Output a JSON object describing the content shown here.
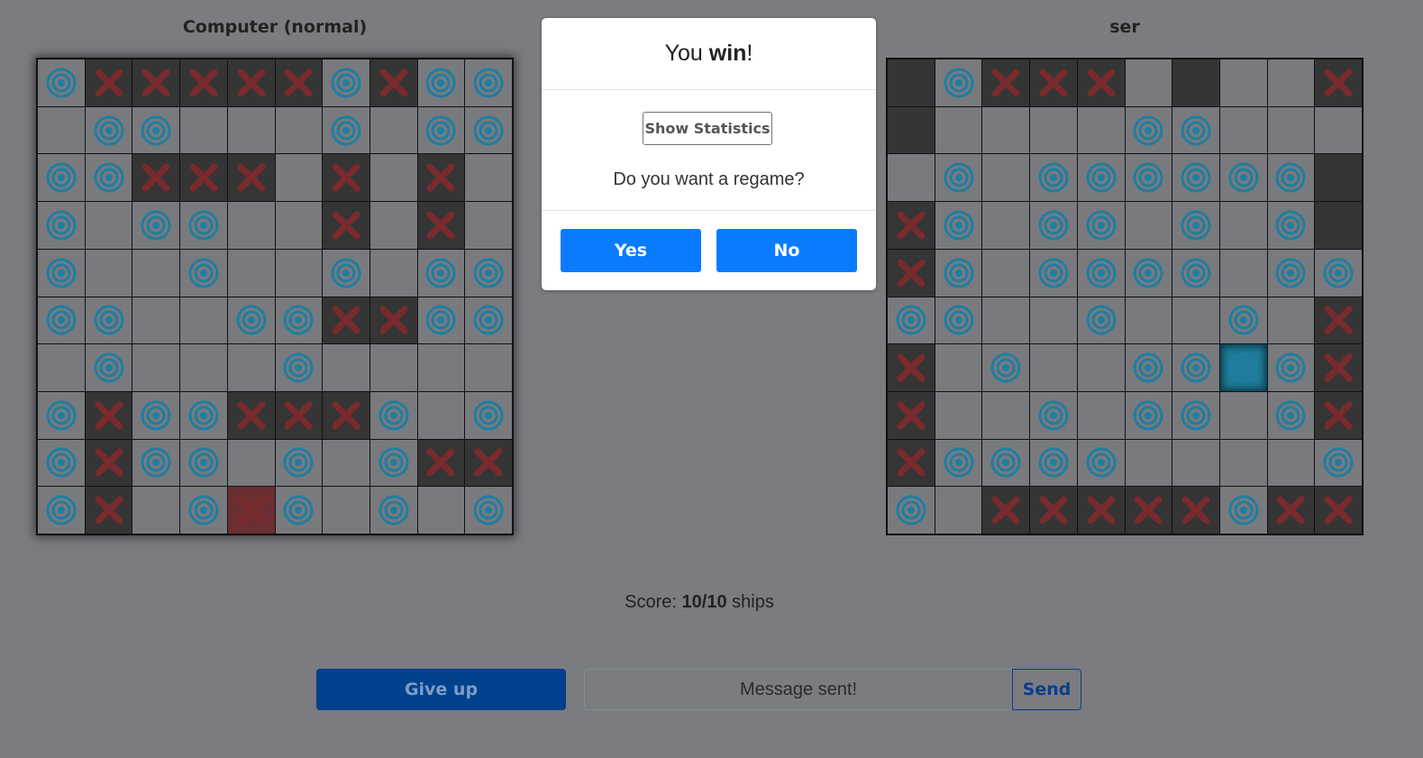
{
  "colors": {
    "background": "#7b7c80",
    "cell_empty": "#797a7e",
    "cell_ship": "#353535",
    "last_hit": "#6b2f33",
    "hit_marker": "#7a2a2c",
    "miss_marker": "#1e7ea1",
    "primary_button": "#0a7bff",
    "give_up_button": "#00418c"
  },
  "boards": {
    "left": {
      "title": "Computer (normal)",
      "legend": "O = miss (target icon), X = hit, S = ship shown, . = empty, L = last hit",
      "rows": [
        [
          "O",
          "X",
          "X",
          "X",
          "X",
          "X",
          "O",
          "X",
          "O",
          "O"
        ],
        [
          ".",
          "O",
          "O",
          ".",
          ".",
          ".",
          "O",
          ".",
          "O",
          "O"
        ],
        [
          "O",
          "O",
          "X",
          "X",
          "X",
          ".",
          "X",
          ".",
          "X",
          "."
        ],
        [
          "O",
          ".",
          "O",
          "O",
          ".",
          ".",
          "X",
          ".",
          "X",
          "."
        ],
        [
          "O",
          ".",
          ".",
          "O",
          ".",
          ".",
          "O",
          ".",
          "O",
          "O"
        ],
        [
          "O",
          "O",
          ".",
          ".",
          "O",
          "O",
          "X",
          "X",
          "O",
          "O"
        ],
        [
          ".",
          "O",
          ".",
          ".",
          ".",
          "O",
          ".",
          ".",
          ".",
          "."
        ],
        [
          "O",
          "X",
          "O",
          "O",
          "X",
          "X",
          "X",
          "O",
          ".",
          "O"
        ],
        [
          "O",
          "X",
          "O",
          "O",
          ".",
          "O",
          ".",
          "O",
          "X",
          "X"
        ],
        [
          "O",
          "X",
          ".",
          "O",
          "L",
          "O",
          ".",
          "O",
          ".",
          "O"
        ]
      ]
    },
    "right": {
      "title": "ser",
      "rows": [
        [
          "S",
          "O",
          "X",
          "X",
          "X",
          ".",
          "S",
          ".",
          ".",
          "X"
        ],
        [
          "S",
          ".",
          ".",
          ".",
          ".",
          "O",
          "O",
          ".",
          ".",
          "."
        ],
        [
          ".",
          "O",
          ".",
          "O",
          "O",
          "O",
          "O",
          "O",
          "O",
          "S"
        ],
        [
          "X",
          "O",
          ".",
          "O",
          "O",
          ".",
          "O",
          ".",
          "O",
          "S"
        ],
        [
          "X",
          "O",
          ".",
          "O",
          "O",
          "O",
          "O",
          ".",
          "O",
          "O"
        ],
        [
          "O",
          "O",
          ".",
          ".",
          "O",
          ".",
          ".",
          "O",
          ".",
          "X"
        ],
        [
          "X",
          ".",
          "O",
          ".",
          ".",
          "O",
          "O",
          "F",
          "O",
          "X"
        ],
        [
          "X",
          ".",
          ".",
          "O",
          ".",
          "O",
          "O",
          ".",
          "O",
          "X"
        ],
        [
          "X",
          "O",
          "O",
          "O",
          "O",
          ".",
          ".",
          ".",
          ".",
          "O"
        ],
        [
          "O",
          ".",
          "X",
          "X",
          "X",
          "X",
          "X",
          "O",
          "X",
          "X"
        ]
      ]
    }
  },
  "modal": {
    "title_prefix": "You ",
    "title_bold": "win",
    "title_suffix": "!",
    "stats_button": "Show Statistics",
    "question": "Do you want a regame?",
    "yes": "Yes",
    "no": "No"
  },
  "score": {
    "label": "Score: ",
    "value": "10/10",
    "unit": " ships"
  },
  "controls": {
    "give_up": "Give up",
    "message_placeholder": "Message sent!",
    "send": "Send"
  }
}
